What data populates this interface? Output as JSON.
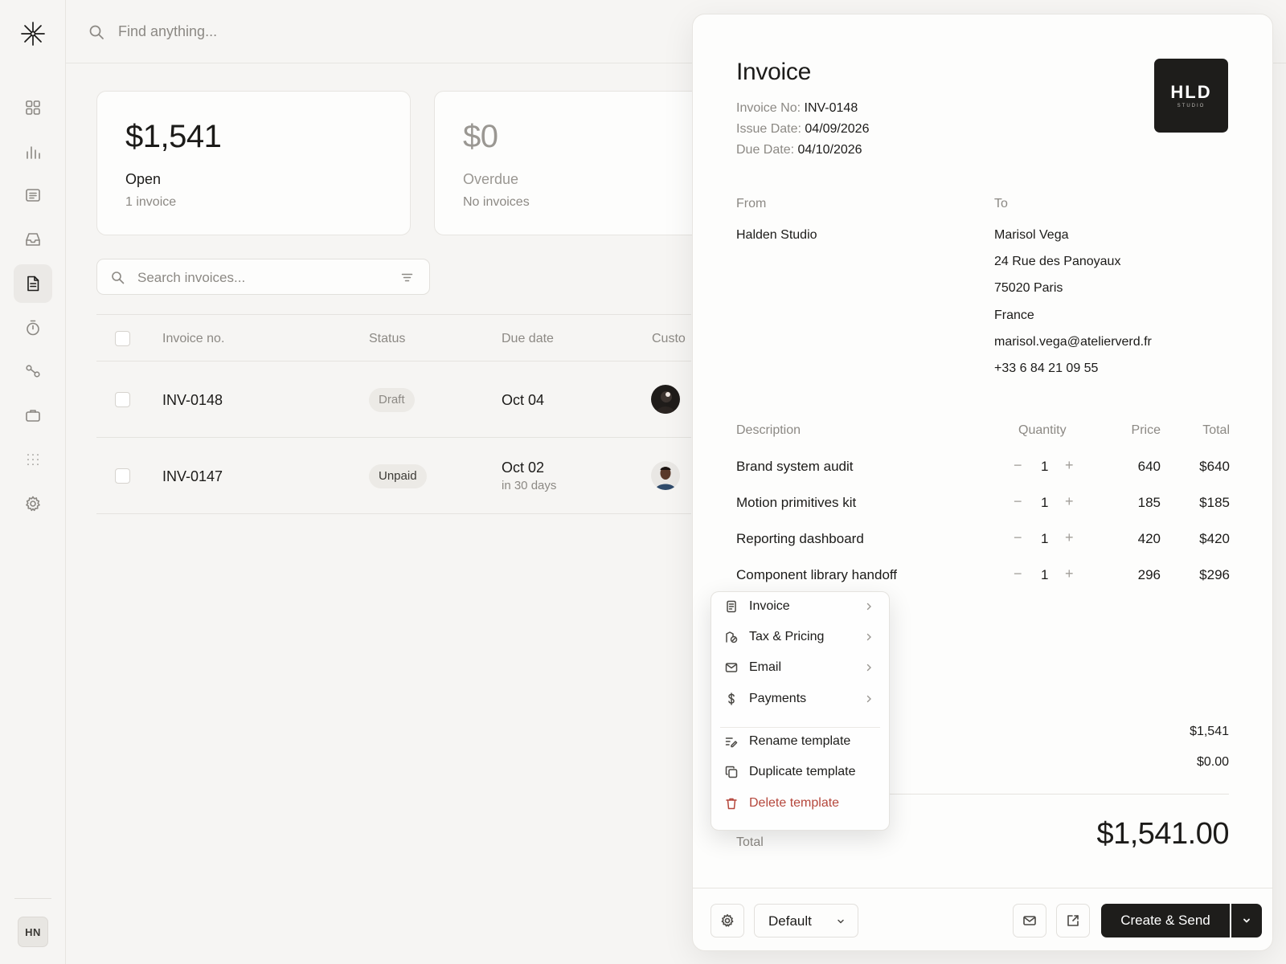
{
  "topbar": {
    "search_placeholder": "Find anything..."
  },
  "sidebar": {
    "items": [
      {
        "icon": "dashboard-icon"
      },
      {
        "icon": "analytics-icon"
      },
      {
        "icon": "document-lines-icon"
      },
      {
        "icon": "inbox-icon"
      },
      {
        "icon": "invoice-icon",
        "active": true
      },
      {
        "icon": "timer-icon"
      },
      {
        "icon": "connections-icon"
      },
      {
        "icon": "briefcase-icon"
      },
      {
        "icon": "apps-grid-icon"
      },
      {
        "icon": "settings-icon"
      }
    ],
    "user_initials": "HN"
  },
  "cards": [
    {
      "amount": "$1,541",
      "label": "Open",
      "sub": "1 invoice"
    },
    {
      "amount": "$0",
      "label": "Overdue",
      "sub": "No invoices"
    }
  ],
  "invoice_search": {
    "placeholder": "Search invoices..."
  },
  "table": {
    "headers": [
      "Invoice no.",
      "Status",
      "Due date",
      "Custo"
    ],
    "rows": [
      {
        "invoice_no": "INV-0148",
        "status": "Draft",
        "due": "Oct 04",
        "due_sub": ""
      },
      {
        "invoice_no": "INV-0147",
        "status": "Unpaid",
        "due": "Oct 02",
        "due_sub": "in 30 days"
      }
    ]
  },
  "panel": {
    "title": "Invoice",
    "meta": [
      {
        "key": "Invoice No:",
        "value": "INV-0148"
      },
      {
        "key": "Issue Date:",
        "value": "04/09/2026"
      },
      {
        "key": "Due Date:",
        "value": "04/10/2026"
      }
    ],
    "logo": {
      "big": "HLD",
      "small": "STUDIO"
    },
    "from_label": "From",
    "to_label": "To",
    "from_name": "Halden Studio",
    "to_lines": [
      "Marisol Vega",
      "24 Rue des Panoyaux",
      "75020 Paris",
      "France",
      "marisol.vega@atelierverd.fr",
      "+33 6 84 21 09 55"
    ],
    "line_headers": {
      "description": "Description",
      "quantity": "Quantity",
      "price": "Price",
      "total": "Total"
    },
    "line_items": [
      {
        "description": "Brand system audit",
        "qty": "1",
        "price": "640",
        "total": "$640"
      },
      {
        "description": "Motion primitives kit",
        "qty": "1",
        "price": "185",
        "total": "$185"
      },
      {
        "description": "Reporting dashboard",
        "qty": "1",
        "price": "420",
        "total": "$420"
      },
      {
        "description": "Component library handoff",
        "qty": "1",
        "price": "296",
        "total": "$296"
      }
    ],
    "qty_minus": "−",
    "qty_plus": "+",
    "subtotal": "$1,541",
    "tax": "$0.00",
    "total_label": "Total",
    "total_value": "$1,541.00",
    "footer": {
      "template": "Default",
      "primary": "Create & Send"
    }
  },
  "menu": {
    "items": [
      {
        "label": "Invoice",
        "icon": "document-icon",
        "submenu": true
      },
      {
        "label": "Tax & Pricing",
        "icon": "tax-icon",
        "submenu": true
      },
      {
        "label": "Email",
        "icon": "mail-icon",
        "submenu": true
      },
      {
        "label": "Payments",
        "icon": "dollar-icon",
        "submenu": true
      },
      {
        "label": "Rename template",
        "icon": "rename-icon",
        "submenu": false
      },
      {
        "label": "Duplicate template",
        "icon": "duplicate-icon",
        "submenu": false
      },
      {
        "label": "Delete template",
        "icon": "trash-icon",
        "submenu": false,
        "danger": true
      }
    ]
  },
  "colors": {
    "accent_dark": "#1e1d1b",
    "danger": "#b5473c",
    "muted_text": "#8c8984"
  }
}
